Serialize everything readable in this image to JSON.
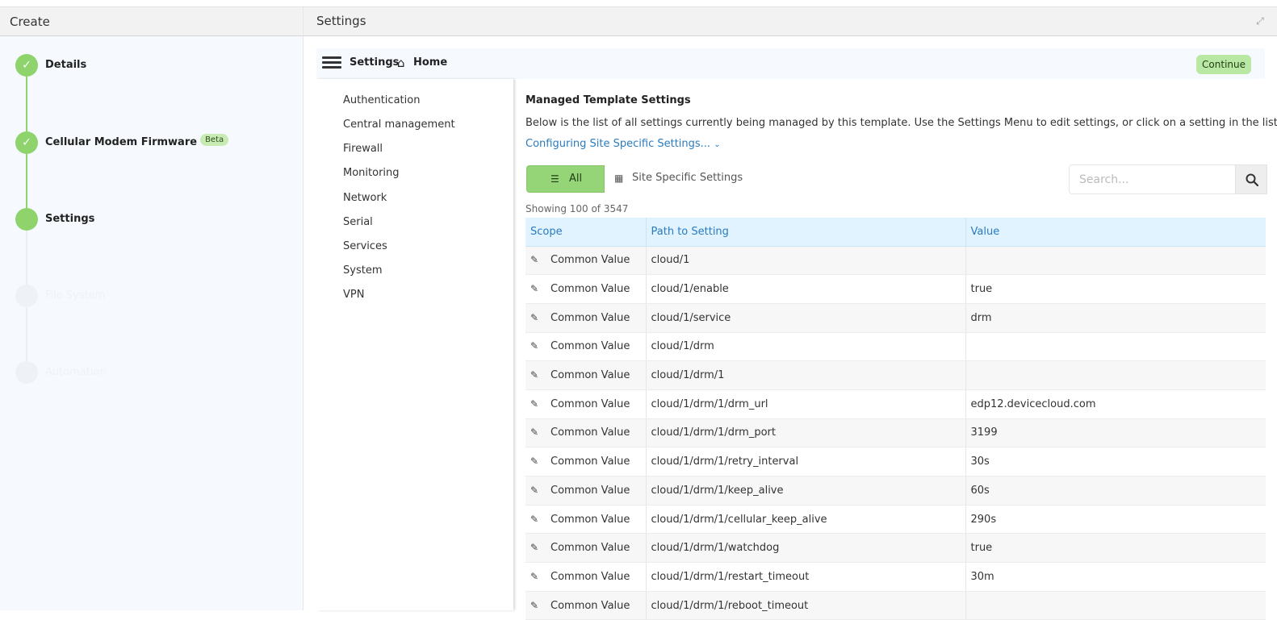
{
  "window": {
    "left_title": "Create",
    "right_title": "Settings"
  },
  "steps": [
    {
      "label": "Details",
      "status": "complete"
    },
    {
      "label": "Cellular Modem Firmware",
      "badge": "Beta",
      "status": "complete"
    },
    {
      "label": "Settings",
      "status": "current"
    },
    {
      "label": "File System",
      "status": "pending"
    },
    {
      "label": "Automation",
      "status": "pending"
    }
  ],
  "toolbar": {
    "settings_label": "Settings",
    "home_label": "Home",
    "continue_label": "Continue"
  },
  "settings_menu": [
    "Authentication",
    "Central management",
    "Firewall",
    "Monitoring",
    "Network",
    "Serial",
    "Services",
    "System",
    "VPN"
  ],
  "main": {
    "title": "Managed Template Settings",
    "description": "Below is the list of all settings currently being managed by this template. Use the Settings Menu to edit settings, or click on a setting in the list below.",
    "config_link": "Configuring Site Specific Settings...",
    "filter_all": "All",
    "filter_site": "Site Specific Settings",
    "search_placeholder": "Search...",
    "showing": "Showing 100 of 3547"
  },
  "table": {
    "headers": [
      "Scope",
      "Path to Setting",
      "Value"
    ],
    "rows": [
      {
        "scope": "Common Value",
        "path": "cloud/1",
        "value": ""
      },
      {
        "scope": "Common Value",
        "path": "cloud/1/enable",
        "value": "true"
      },
      {
        "scope": "Common Value",
        "path": "cloud/1/service",
        "value": "drm"
      },
      {
        "scope": "Common Value",
        "path": "cloud/1/drm",
        "value": ""
      },
      {
        "scope": "Common Value",
        "path": "cloud/1/drm/1",
        "value": ""
      },
      {
        "scope": "Common Value",
        "path": "cloud/1/drm/1/drm_url",
        "value": "edp12.devicecloud.com"
      },
      {
        "scope": "Common Value",
        "path": "cloud/1/drm/1/drm_port",
        "value": "3199"
      },
      {
        "scope": "Common Value",
        "path": "cloud/1/drm/1/retry_interval",
        "value": "30s"
      },
      {
        "scope": "Common Value",
        "path": "cloud/1/drm/1/keep_alive",
        "value": "60s"
      },
      {
        "scope": "Common Value",
        "path": "cloud/1/drm/1/cellular_keep_alive",
        "value": "290s"
      },
      {
        "scope": "Common Value",
        "path": "cloud/1/drm/1/watchdog",
        "value": "true"
      },
      {
        "scope": "Common Value",
        "path": "cloud/1/drm/1/restart_timeout",
        "value": "30m"
      },
      {
        "scope": "Common Value",
        "path": "cloud/1/drm/1/reboot_timeout",
        "value": ""
      }
    ]
  },
  "colors": {
    "accent_green": "#8ed36b",
    "link_blue": "#2a7bbf",
    "header_blue": "#e0f3ff"
  }
}
